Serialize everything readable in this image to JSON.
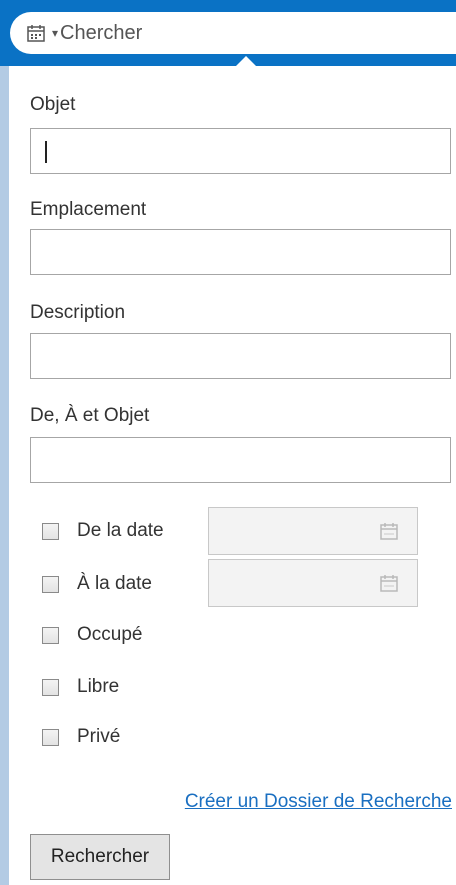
{
  "search": {
    "placeholder": "Chercher",
    "caret": "▾"
  },
  "form": {
    "subject_label": "Objet",
    "location_label": "Emplacement",
    "description_label": "Description",
    "from_to_subject_label": "De, À et Objet",
    "subject_value": "",
    "location_value": "",
    "description_value": "",
    "from_to_subject_value": ""
  },
  "options": [
    {
      "label": "De la date",
      "checked": false
    },
    {
      "label": "À la date",
      "checked": false
    },
    {
      "label": "Occupé",
      "checked": false
    },
    {
      "label": "Libre",
      "checked": false
    },
    {
      "label": "Privé",
      "checked": false
    }
  ],
  "create_search_folder_link": "Créer un Dossier de Recherche",
  "search_button": "Rechercher",
  "colors": {
    "header_blue": "#0a72c5",
    "link_blue": "#1a6fc1",
    "side_strip": "#b3cbe4"
  }
}
